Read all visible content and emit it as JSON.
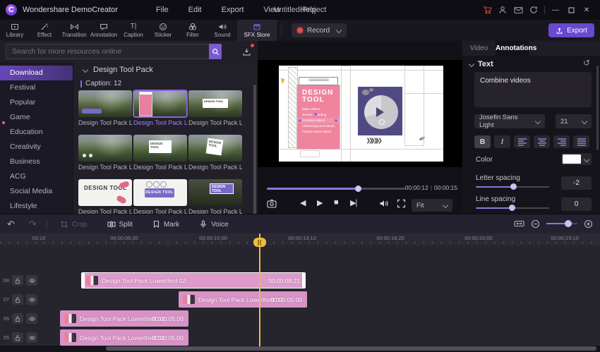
{
  "titlebar": {
    "app_name": "Wondershare DemoCreator",
    "menus": [
      "File",
      "Edit",
      "Export",
      "View",
      "Help"
    ],
    "project_title": "Untitled Project"
  },
  "ribbon": {
    "tabs": [
      "Library",
      "Effect",
      "Transition",
      "Annotation",
      "Caption",
      "Sticker",
      "Filter",
      "Sound",
      "SFX Store"
    ],
    "active_tab": "SFX Store",
    "record_label": "Record",
    "export_label": "Export"
  },
  "library": {
    "search_placeholder": "Search for more resources online",
    "categories": [
      "Download",
      "Festival",
      "Popular",
      "Game",
      "Education",
      "Creativity",
      "Business",
      "ACG",
      "Social Media",
      "Lifestyle"
    ],
    "active_category": "Download",
    "group_title": "Design Tool Pack",
    "group_count": "Caption: 12",
    "item_label": "Design Tool Pack Lowert...",
    "thumb_text": "DESIGN TOOL"
  },
  "preview": {
    "poster": {
      "title": "DESIGN TOOL",
      "lines": [
        "Make videos",
        "Screen recording",
        "Combine videos",
        "Add Background Music",
        "Feature stock videos"
      ],
      "arrows": "»»»"
    },
    "current_time": "00:00:12",
    "divider": "|",
    "total_time": "00:00:15",
    "zoom_mode": "Fit"
  },
  "inspector": {
    "tabs": [
      "Video",
      "Annotations"
    ],
    "active_tab": "Annotations",
    "section_title": "Text",
    "text_content": "Combine videos",
    "font_family": "Josefin Sans Light",
    "font_size": "21",
    "bold_label": "B",
    "italic_label": "I",
    "color_label": "Color",
    "letter_spacing_label": "Letter spacing",
    "letter_spacing_value": "-2",
    "line_spacing_label": "Line spacing",
    "line_spacing_value": "0"
  },
  "timeline": {
    "undo": "↶",
    "redo": "↷",
    "tools": {
      "crop": "Crop",
      "split": "Split",
      "mark": "Mark",
      "voice": "Voice"
    },
    "ruler_labels": [
      "03:10",
      "00:00:06:20",
      "00:00:10:00",
      "00:00:13:10",
      "00:00:16:20",
      "00:00:20:00",
      "00:00:23:10"
    ],
    "playhead_label": "][",
    "tracks": [
      {
        "number": "08"
      },
      {
        "number": "07"
      },
      {
        "number": "06"
      },
      {
        "number": "05"
      }
    ],
    "clips": [
      {
        "name": "Design Tool Pack Lowerthird 02",
        "duration": "00:00:08:21"
      },
      {
        "name": "Design Tool Pack Lowerthird 02",
        "duration": "00:00:05:00"
      },
      {
        "name": "Design Tool Pack Lowerthird 02",
        "duration": "00:00:05:00"
      },
      {
        "name": "Design Tool Pack Lowerthird 02",
        "duration": "00:00:05:00"
      }
    ]
  }
}
